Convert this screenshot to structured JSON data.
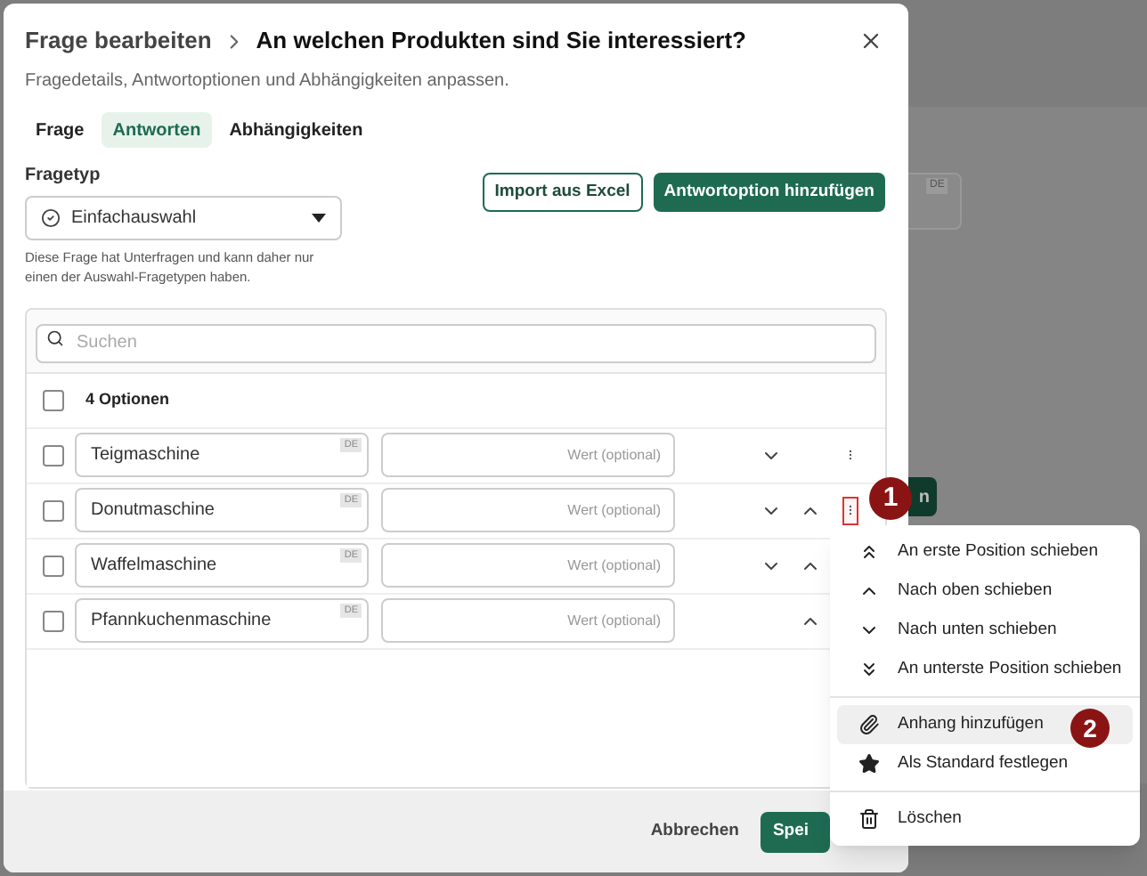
{
  "backdrop": {
    "field_badge": "DE",
    "button_text": "n"
  },
  "dialog": {
    "breadcrumb": "Frage bearbeiten",
    "title": "An welchen Produkten sind Sie interessiert?",
    "subtitle": "Fragedetails, Antwortoptionen und Abhängigkeiten anpassen.",
    "tabs": [
      {
        "label": "Frage",
        "selected": false
      },
      {
        "label": "Antworten",
        "selected": true
      },
      {
        "label": "Abhängigkeiten",
        "selected": false
      }
    ],
    "question_type": {
      "label": "Fragetyp",
      "value": "Einfachauswahl",
      "hint": "Diese Frage hat Unterfragen und kann daher nur einen der Auswahl-Fragetypen haben."
    },
    "buttons": [
      {
        "label": "Import aus Excel",
        "kind": "outline"
      },
      {
        "label": "Antwortoption hinzufügen",
        "kind": "primary"
      }
    ],
    "search": {
      "placeholder": "Suchen"
    },
    "options_header": {
      "label": "4 Optionen",
      "checked": false
    },
    "options": [
      {
        "name": "Teigmaschine",
        "language": "DE",
        "value_placeholder": "Wert (optional)",
        "checked": false,
        "can_move_down": true,
        "can_move_up": false,
        "menu_visible": true,
        "menu_open": false
      },
      {
        "name": "Donutmaschine",
        "language": "DE",
        "value_placeholder": "Wert (optional)",
        "checked": false,
        "can_move_down": true,
        "can_move_up": true,
        "menu_visible": true,
        "menu_open": true
      },
      {
        "name": "Waffelmaschine",
        "language": "DE",
        "value_placeholder": "Wert (optional)",
        "checked": false,
        "can_move_down": true,
        "can_move_up": true,
        "menu_visible": false
      },
      {
        "name": "Pfannkuchenmaschine",
        "language": "DE",
        "value_placeholder": "Wert (optional)",
        "checked": false,
        "can_move_down": false,
        "can_move_up": true,
        "menu_visible": false
      }
    ],
    "footer": {
      "cancel": "Abbrechen",
      "save": "Spei"
    }
  },
  "menu": [
    {
      "label": "An erste Position schieben",
      "divider_before": false,
      "highlighted": false
    },
    {
      "label": "Nach oben schieben",
      "divider_before": false,
      "highlighted": false
    },
    {
      "label": "Nach unten schieben",
      "divider_before": false,
      "highlighted": false
    },
    {
      "label": "An unterste Position schieben",
      "divider_before": false,
      "highlighted": false
    },
    {
      "label": "Anhang hinzufügen",
      "divider_before": true,
      "highlighted": true
    },
    {
      "label": "Als Standard festlegen",
      "divider_before": false,
      "highlighted": false
    },
    {
      "label": "Löschen",
      "divider_before": true,
      "highlighted": false
    }
  ],
  "annotations": [
    "1",
    "2"
  ]
}
